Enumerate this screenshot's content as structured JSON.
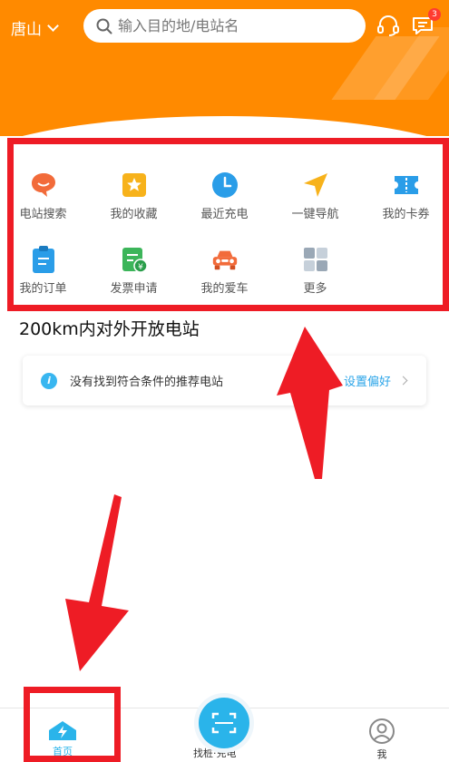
{
  "header": {
    "city": "唐山",
    "search_placeholder": "输入目的地/电站名",
    "message_badge": "3"
  },
  "shortcuts": [
    {
      "label": "电站搜索",
      "icon": "chat-bubble-icon"
    },
    {
      "label": "我的收藏",
      "icon": "star-icon"
    },
    {
      "label": "最近充电",
      "icon": "clock-icon"
    },
    {
      "label": "一键导航",
      "icon": "navigation-icon"
    },
    {
      "label": "我的卡券",
      "icon": "coupon-icon"
    },
    {
      "label": "我的订单",
      "icon": "clipboard-icon"
    },
    {
      "label": "发票申请",
      "icon": "invoice-icon"
    },
    {
      "label": "我的爱车",
      "icon": "car-icon"
    },
    {
      "label": "更多",
      "icon": "grid-icon"
    }
  ],
  "section_title": "200km内对外开放电站",
  "notice": {
    "message": "没有找到符合条件的推荐电站",
    "link": "设置偏好"
  },
  "tabs": [
    {
      "label": "首页",
      "icon": "home-icon",
      "active": true
    },
    {
      "label": "找桩·充电",
      "icon": "scan-icon",
      "active": false
    },
    {
      "label": "我",
      "icon": "user-icon",
      "active": false
    }
  ],
  "colors": {
    "brand_orange": "#ff8a00",
    "accent_blue": "#2ab4ea",
    "annotation_red": "#ee1c25"
  }
}
